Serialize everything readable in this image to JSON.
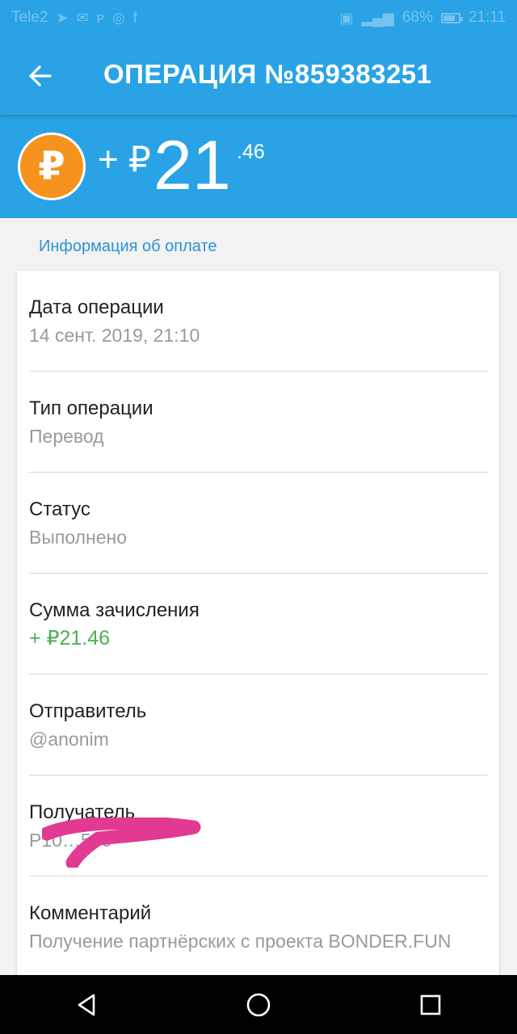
{
  "status_bar": {
    "carrier": "Tele2",
    "battery_level": "68%",
    "time": "21:11"
  },
  "app_bar": {
    "title": "ОПЕРАЦИЯ №859383251"
  },
  "amount": {
    "currency_symbol": "₽",
    "prefix": "+ ₽",
    "main": "21",
    "cents": ".46"
  },
  "section": {
    "title": "Информация об оплате"
  },
  "details": [
    {
      "label": "Дата операции",
      "value": "14 сент. 2019, 21:10"
    },
    {
      "label": "Тип операции",
      "value": "Перевод"
    },
    {
      "label": "Статус",
      "value": "Выполнено"
    },
    {
      "label": "Сумма зачисления",
      "value": "+ ₽21.46"
    },
    {
      "label": "Отправитель",
      "value": "@anonim"
    },
    {
      "label": "Получатель",
      "value": "P10…530"
    },
    {
      "label": "Комментарий",
      "value": "Получение партнёрских с проекта BONDER.FUN"
    }
  ],
  "colors": {
    "primary": "#2aa3e6",
    "coin": "#f5931e",
    "positive": "#4caf50",
    "redaction": "#e23a93"
  }
}
